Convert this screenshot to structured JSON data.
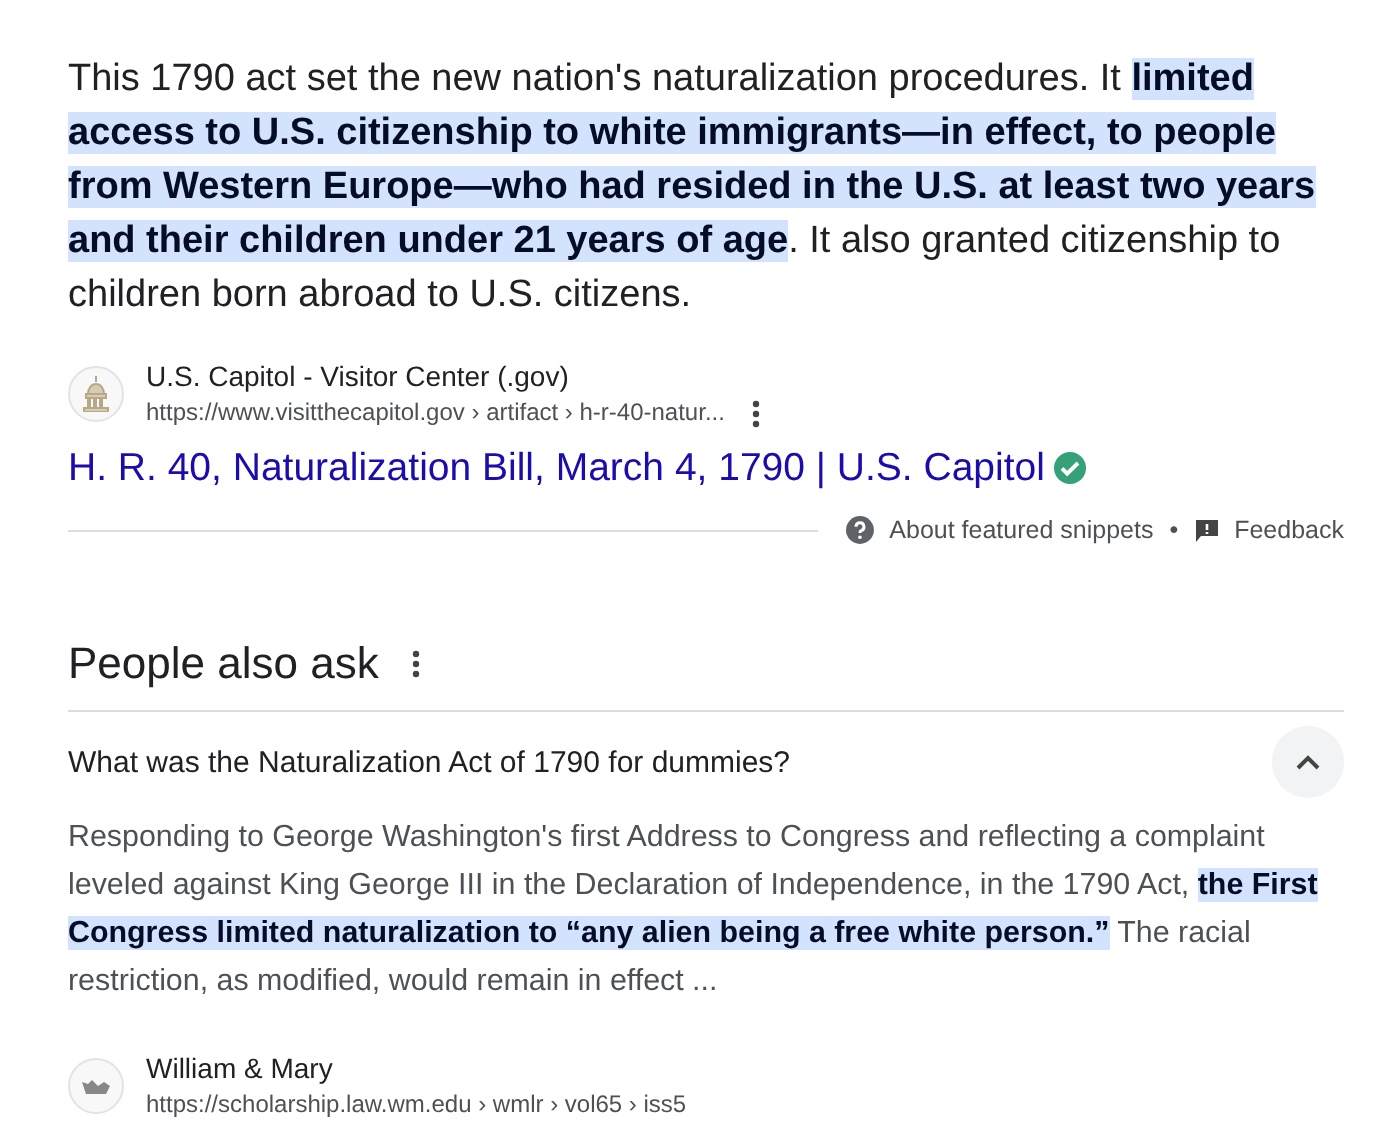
{
  "featured_snippet": {
    "text": [
      {
        "text": "This 1790 act set the new nation's naturalization procedures. It ",
        "highlighted": false
      },
      {
        "text": "limited access to U.S. citizenship to white immigrants—in effect, to people from Western Europe—who had resided in the U.S. at least two years and their children under 21 years of age",
        "highlighted": true
      },
      {
        "text": ". It also granted citizenship to children born abroad to U.S. citizens.",
        "highlighted": false
      }
    ],
    "source": {
      "site": "U.S. Capitol - Visitor Center (.gov)",
      "url": "https://www.visitthecapitol.gov › artifact › h-r-40-natur..."
    },
    "title": "H. R. 40, Naturalization Bill, March 4, 1790 | U.S. Capitol",
    "verified": true,
    "footer": {
      "about": "About featured snippets",
      "separator": "•",
      "feedback": "Feedback"
    }
  },
  "people_also_ask": {
    "heading": "People also ask",
    "questions": [
      {
        "question": "What was the Naturalization Act of 1790 for dummies?",
        "expanded": true,
        "answer": [
          {
            "text": "Responding to George Washington's first Address to Congress and reflecting a complaint leveled against King George III in the Declaration of Independence, in the 1790 Act, ",
            "highlighted": false
          },
          {
            "text": "the First Congress limited naturalization to “any alien being a free white person.”",
            "highlighted": true
          },
          {
            "text": " The racial restriction, as modified, would remain in effect ...",
            "highlighted": false
          }
        ],
        "source": {
          "site": "William & Mary",
          "url": "https://scholarship.law.wm.edu › wmlr › vol65 › iss5"
        }
      }
    ]
  }
}
